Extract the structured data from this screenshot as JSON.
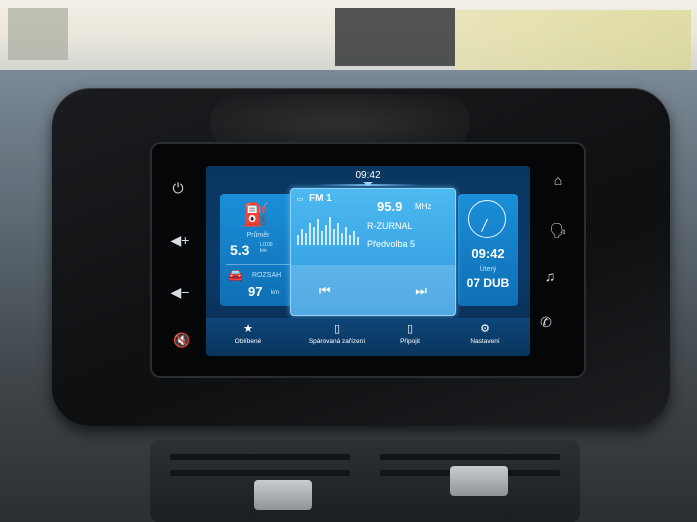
{
  "status_bar": {
    "time": "09:42"
  },
  "side_buttons": {
    "left": [
      "power-icon",
      "volume-up-icon",
      "volume-down-icon",
      "mute-icon"
    ],
    "right": [
      "home-icon",
      "voice-icon",
      "music-icon",
      "phone-icon"
    ]
  },
  "consumption": {
    "avg_label": "Průměr",
    "avg_value": "5.3",
    "avg_unit_top": "L/100",
    "avg_unit_bottom": "km",
    "range_label": "ROZSAH",
    "range_value": "97",
    "range_unit": "km"
  },
  "radio": {
    "band": "FM 1",
    "frequency": "95.9",
    "frequency_unit": "MHz",
    "station": "R-ZURNAL",
    "preset": "Předvolba 5"
  },
  "clock_tile": {
    "time": "09:42",
    "day": "Úterý",
    "date": "07 DUB"
  },
  "menu": {
    "favorites": "Oblíbené",
    "paired_devices": "Spárovaná zařízení",
    "connect": "Připojit",
    "settings": "Nastavení"
  },
  "colors": {
    "screen_bg": "#0b3a6a",
    "tile_blue": "#1a8fd8",
    "radio_highlight": "#4db9f0",
    "menu_bg": "#0e4679"
  }
}
